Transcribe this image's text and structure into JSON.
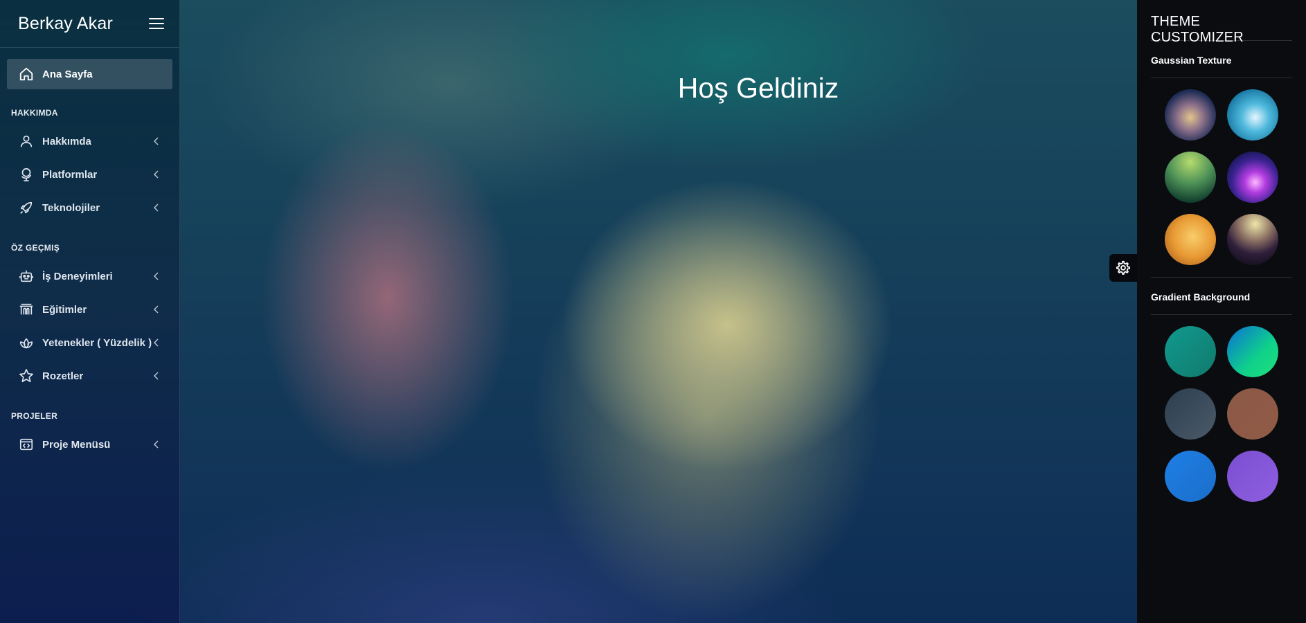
{
  "sidebar": {
    "brand": "Berkay Akar",
    "active_item": {
      "label": "Ana Sayfa",
      "icon": "home-icon"
    },
    "sections": [
      {
        "header": "HAKKIMDA",
        "items": [
          {
            "label": "Hakkımda",
            "icon": "user-icon"
          },
          {
            "label": "Platformlar",
            "icon": "globe-icon"
          },
          {
            "label": "Teknolojiler",
            "icon": "rocket-icon"
          }
        ]
      },
      {
        "header": "ÖZ GEÇMIŞ",
        "items": [
          {
            "label": "İş Deneyimleri",
            "icon": "robot-icon"
          },
          {
            "label": "Eğitimler",
            "icon": "building-icon"
          },
          {
            "label": "Yetenekler ( Yüzdelik )",
            "icon": "lotus-icon"
          },
          {
            "label": "Rozetler",
            "icon": "star-icon"
          }
        ]
      },
      {
        "header": "PROJELER",
        "items": [
          {
            "label": "Proje Menüsü",
            "icon": "code-window-icon"
          }
        ]
      }
    ]
  },
  "main": {
    "title": "Hoş Geldiniz"
  },
  "customizer": {
    "title": "THEME CUSTOMIZER",
    "gaussian_label": "Gaussian Texture",
    "gradient_label": "Gradient Background"
  },
  "colors": {
    "customizer_bg": "#0b0c10",
    "accent_teal": "#11998e"
  }
}
